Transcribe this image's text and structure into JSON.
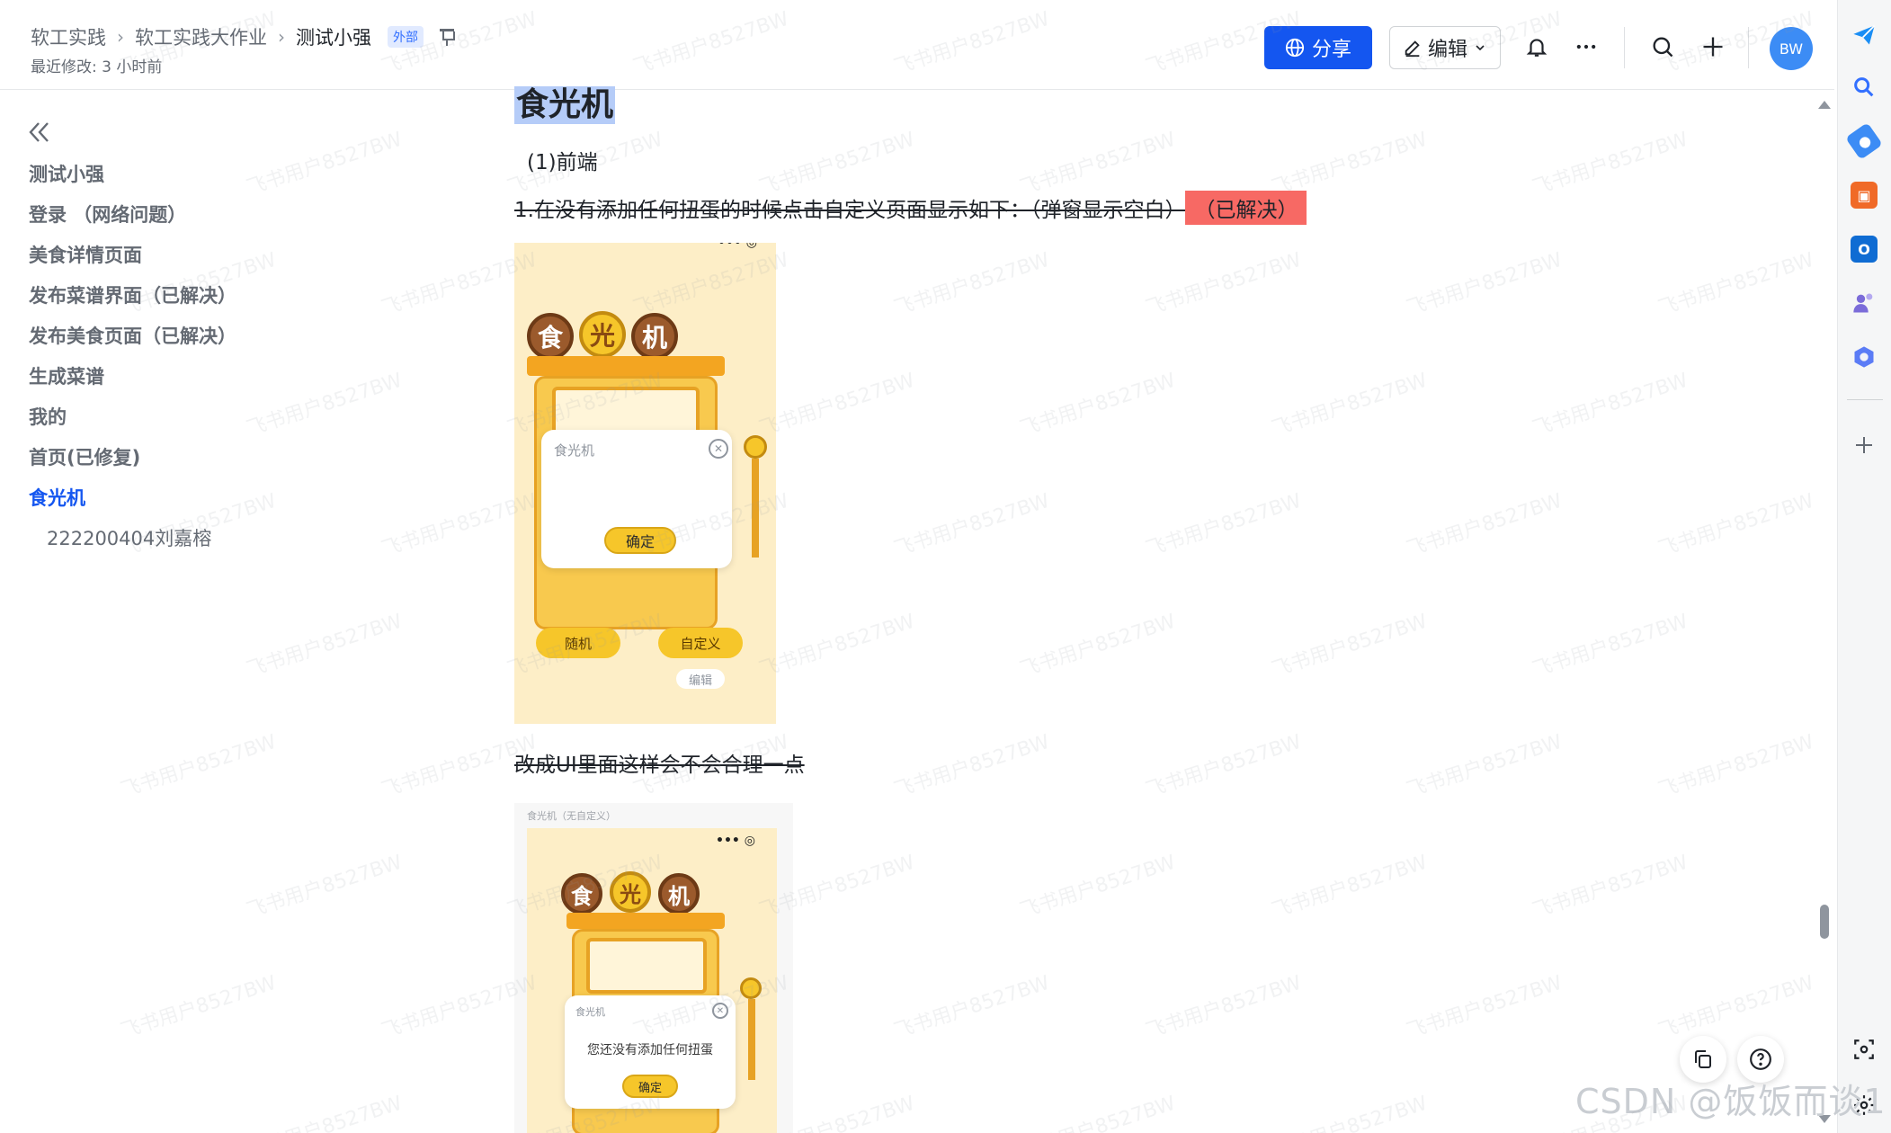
{
  "header": {
    "breadcrumb": [
      "软工实践",
      "软工实践大作业",
      "测试小强"
    ],
    "badge": "外部",
    "last_modified": "最近修改: 3 小时前",
    "share_label": "分享",
    "edit_label": "编辑",
    "avatar_initials": "BW"
  },
  "outline": {
    "items": [
      {
        "label": "测试小强",
        "active": false
      },
      {
        "label": "登录 （网络问题）",
        "active": false
      },
      {
        "label": "美食详情页面",
        "active": false
      },
      {
        "label": "发布菜谱界面（已解决）",
        "active": false
      },
      {
        "label": "发布美食页面（已解决）",
        "active": false
      },
      {
        "label": "生成菜谱",
        "active": false
      },
      {
        "label": "我的",
        "active": false
      },
      {
        "label": "首页(已修复)",
        "active": false
      },
      {
        "label": "食光机",
        "active": true
      }
    ],
    "sub_item": "222200404刘嘉榕"
  },
  "content": {
    "title": "食光机",
    "subheading": "(1)前端",
    "issue_text": "1.在没有添加任何扭蛋的时候点击自定义页面显示如下：（弹窗显示空白）",
    "issue_status": "（已解决）",
    "suggestion": "改成UI里面这样会不会合理一点",
    "shot1": {
      "logo_chars": [
        "食",
        "光",
        "机"
      ],
      "dialog_title": "食光机",
      "ok_label": "确定",
      "random_label": "随机",
      "custom_label": "自定义",
      "edit_label": "编辑"
    },
    "shot2": {
      "caption": "食光机（无自定义）",
      "logo_chars": [
        "食",
        "光",
        "机"
      ],
      "dialog_title": "食光机",
      "dialog_message": "您还没有添加任何扭蛋",
      "ok_label": "确定"
    }
  },
  "watermark": "飞书用户8527BW",
  "csdn_mark": "CSDN @饭饭而谈1",
  "colors": {
    "primary": "#1456f0",
    "title_highlight": "#b5ccf8",
    "resolved_highlight": "#f76964",
    "active_outline": "#1456f0"
  },
  "right_rail_icons": [
    "send-icon",
    "search-icon",
    "tag-icon",
    "toolbox-icon",
    "outlook-icon",
    "people-icon",
    "copilot-icon",
    "plus-icon",
    "screenshot-icon",
    "settings-icon"
  ]
}
